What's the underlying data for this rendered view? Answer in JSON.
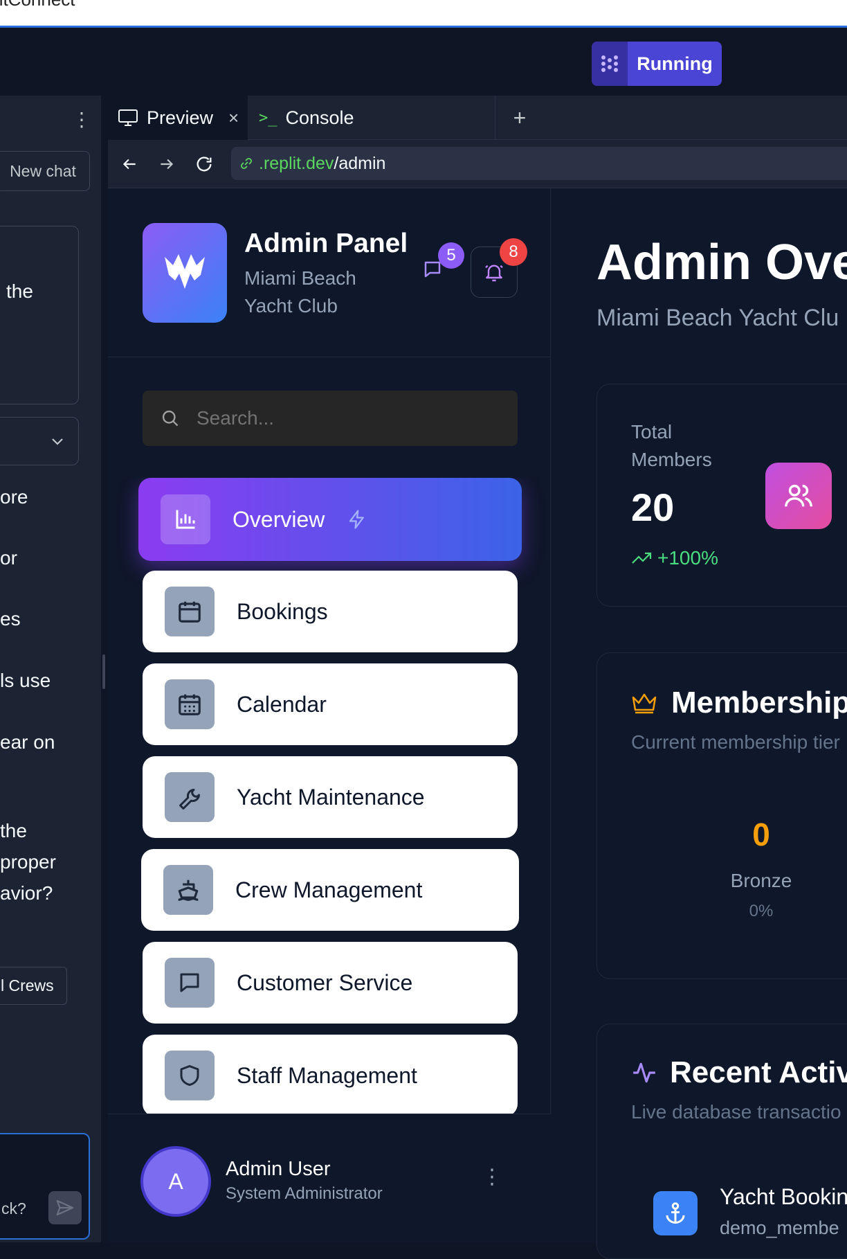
{
  "browser": {
    "top_partial_title": "ntConnect",
    "run_status": "Running",
    "tabs": [
      {
        "label": "Preview"
      },
      {
        "label": "Console"
      }
    ],
    "url_domain": ".replit.dev",
    "url_path": "/admin"
  },
  "chat": {
    "new_chat_label": "New chat",
    "box_text": "the",
    "lines": [
      "ore",
      "or",
      "es",
      "ls use",
      "ear on",
      "the",
      "proper",
      "avior?"
    ],
    "crews_button": "l Crews",
    "input_placeholder": "ck?"
  },
  "sidebar": {
    "title": "Admin Panel",
    "subtitle_line1": "Miami Beach",
    "subtitle_line2": "Yacht Club",
    "message_badge": "5",
    "notification_badge": "8",
    "search_placeholder": "Search...",
    "nav": [
      {
        "label": "Overview",
        "icon": "bar-chart-icon",
        "active": true
      },
      {
        "label": "Bookings",
        "icon": "calendar-icon"
      },
      {
        "label": "Calendar",
        "icon": "calendar-grid-icon"
      },
      {
        "label": "Yacht Maintenance",
        "icon": "wrench-icon"
      },
      {
        "label": "Crew Management",
        "icon": "ship-icon"
      },
      {
        "label": "Customer Service",
        "icon": "message-square-icon"
      },
      {
        "label": "Staff Management",
        "icon": "shield-icon"
      }
    ],
    "user": {
      "initial": "A",
      "name": "Admin User",
      "role": "System Administrator"
    }
  },
  "main": {
    "title": "Admin Ove",
    "subtitle": "Miami Beach Yacht Clu",
    "stat": {
      "label_line1": "Total",
      "label_line2": "Members",
      "value": "20",
      "trend": "+100%"
    },
    "membership": {
      "title": "Membership",
      "subtitle": "Current membership tier",
      "tier_value": "0",
      "tier_name": "Bronze",
      "tier_pct": "0%"
    },
    "activity": {
      "title": "Recent Activ",
      "subtitle": "Live database transactio",
      "item_title": "Yacht Bookin",
      "item_user": "demo_membe"
    }
  },
  "colors": {
    "accent_purple": "#8b5cf6",
    "accent_blue": "#3b82f6",
    "bronze": "#f59e0b",
    "trend_green": "#4ade80",
    "badge_red": "#ef4444"
  }
}
